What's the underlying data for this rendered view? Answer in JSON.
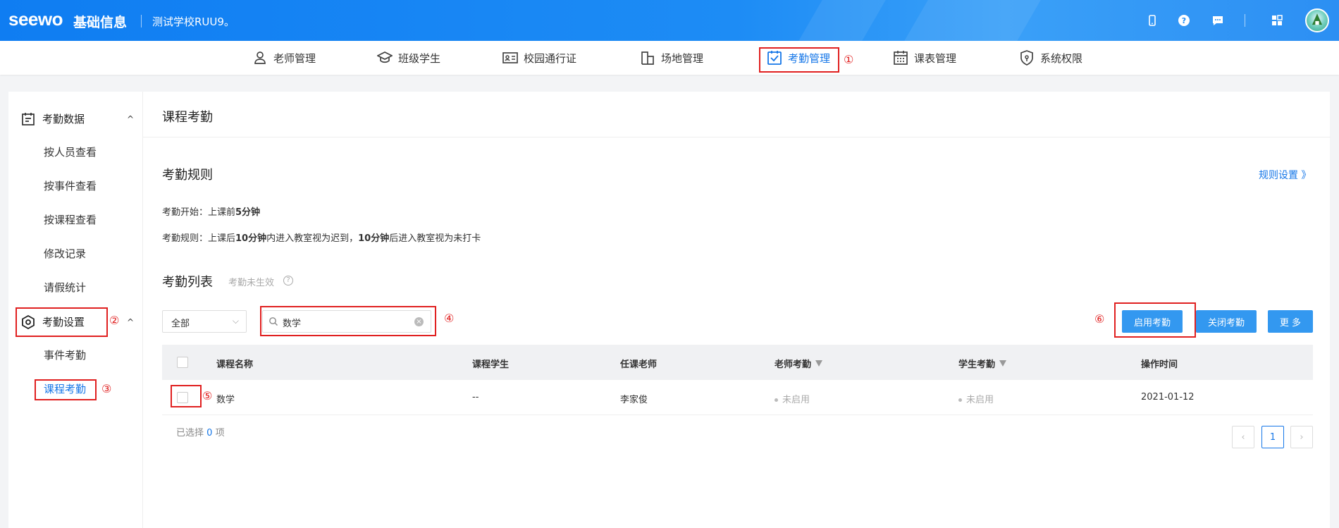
{
  "header": {
    "logo": "seewo",
    "product": "基础信息",
    "school": "测试学校RUU9。"
  },
  "topnav": {
    "items": [
      {
        "label": "老师管理",
        "icon": "user-icon"
      },
      {
        "label": "班级学生",
        "icon": "graduation-cap-icon"
      },
      {
        "label": "校园通行证",
        "icon": "id-card-icon"
      },
      {
        "label": "场地管理",
        "icon": "building-icon"
      },
      {
        "label": "考勤管理",
        "icon": "clipboard-check-icon",
        "active": true
      },
      {
        "label": "课表管理",
        "icon": "calendar-icon"
      },
      {
        "label": "系统权限",
        "icon": "shield-icon"
      }
    ]
  },
  "sidebar": {
    "group1": {
      "label": "考勤数据",
      "icon": "clipboard-icon",
      "chevron": "^"
    },
    "group1_items": [
      "按人员查看",
      "按事件查看",
      "按课程查看",
      "修改记录",
      "请假统计"
    ],
    "group2": {
      "label": "考勤设置",
      "icon": "hexagon-gear-icon",
      "chevron": "^"
    },
    "group2_items": [
      "事件考勤",
      "课程考勤"
    ]
  },
  "main": {
    "page_title": "课程考勤",
    "rules_title": "考勤规则",
    "rules_link": "规则设置 》",
    "rule1": {
      "prefix": "考勤开始：上课前",
      "bold": "5分钟"
    },
    "rule2": {
      "prefix": "考勤规则：上课后",
      "bold1": "10分钟",
      "mid": "内进入教室视为迟到，",
      "bold2": "10分钟",
      "suffix": "后进入教室视为未打卡"
    },
    "list_title": "考勤列表",
    "list_hint": "考勤未生效",
    "filter_value": "全部",
    "search_value": "数学",
    "buttons": {
      "enable": "启用考勤",
      "disable": "关闭考勤",
      "more": "更 多"
    },
    "table": {
      "columns": [
        "课程名称",
        "课程学生",
        "任课老师",
        "老师考勤",
        "学生考勤",
        "操作时间"
      ],
      "rows": [
        {
          "course": "数学",
          "students": "--",
          "teacher": "李家俊",
          "teacher_att": "未启用",
          "student_att": "未启用",
          "time": "2021-01-12"
        }
      ]
    },
    "selected_prefix": "已选择",
    "selected_count": "0",
    "selected_suffix": "项",
    "page_current": "1"
  },
  "annotations": [
    "①",
    "②",
    "③",
    "④",
    "⑤",
    "⑥"
  ],
  "colors": {
    "accent": "#1677e8",
    "button": "#3398f0",
    "annotation": "#e02020"
  }
}
